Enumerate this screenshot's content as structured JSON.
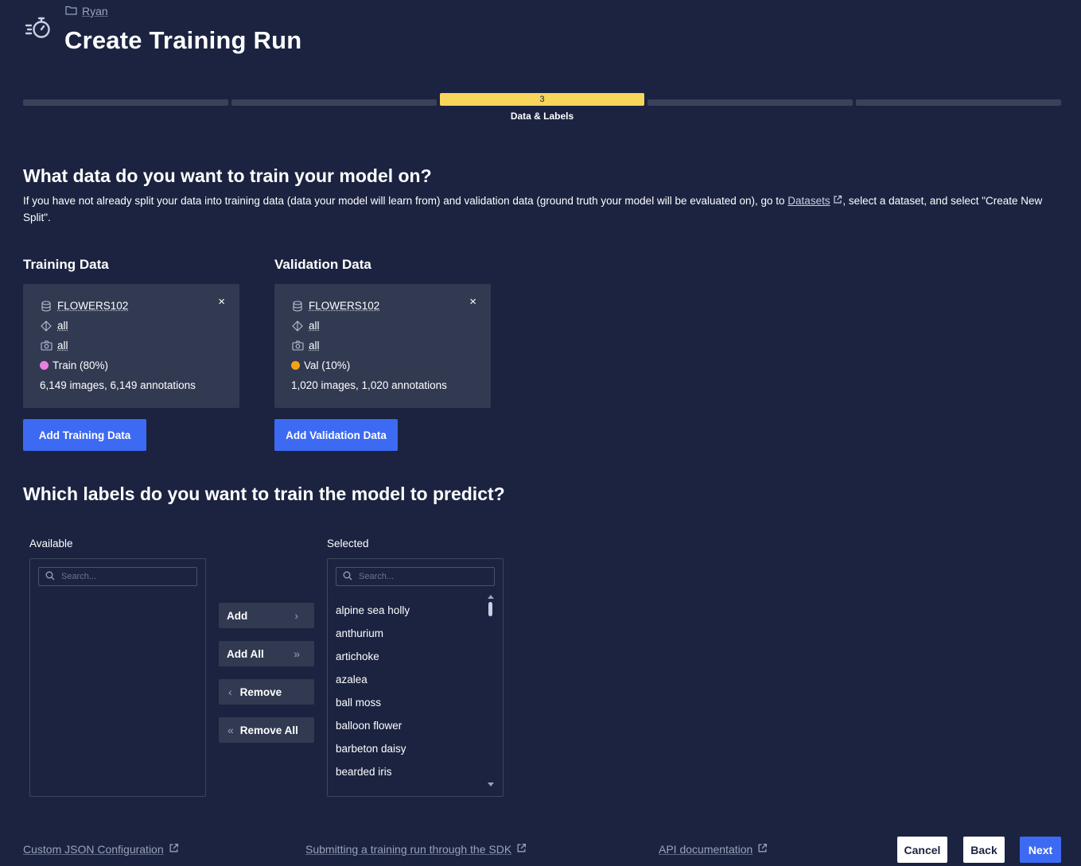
{
  "header": {
    "breadcrumb": "Ryan",
    "title": "Create Training Run"
  },
  "stepper": {
    "active_number": "3",
    "active_label": "Data & Labels",
    "accent_color": "#f7d65c"
  },
  "data_section": {
    "title": "What data do you want to train your model on?",
    "description_before": "If you have not already split your data into training data (data your model will learn from) and validation data (ground truth your model will be evaluated on), go to ",
    "description_link": "Datasets",
    "description_after": ", select a dataset, and select \"Create New Split\"."
  },
  "training": {
    "heading": "Training Data",
    "dataset": "FLOWERS102",
    "annotation_filter": "all",
    "image_filter": "all",
    "split": "Train (80%)",
    "split_color": "#e87fe0",
    "summary": "6,149 images, 6,149 annotations",
    "close": "×",
    "add_button": "Add Training Data"
  },
  "validation": {
    "heading": "Validation Data",
    "dataset": "FLOWERS102",
    "annotation_filter": "all",
    "image_filter": "all",
    "split": "Val (10%)",
    "split_color": "#f5a30f",
    "summary": "1,020 images, 1,020 annotations",
    "close": "×",
    "add_button": "Add Validation Data"
  },
  "labels_section": {
    "title": "Which labels do you want to train the model to predict?",
    "available": {
      "label": "Available",
      "search_placeholder": "Search..."
    },
    "selected": {
      "label": "Selected",
      "search_placeholder": "Search...",
      "items": [
        "alpine sea holly",
        "anthurium",
        "artichoke",
        "azalea",
        "ball moss",
        "balloon flower",
        "barbeton daisy",
        "bearded iris"
      ]
    },
    "buttons": {
      "add": "Add",
      "add_all": "Add All",
      "remove": "Remove",
      "remove_all": "Remove All"
    }
  },
  "footer": {
    "link_json": "Custom JSON Configuration",
    "link_sdk": "Submitting a training run through the SDK",
    "link_api": "API documentation",
    "cancel": "Cancel",
    "back": "Back",
    "next": "Next"
  },
  "colors": {
    "background": "#1b2340",
    "card": "#323a52",
    "primary": "#3d6af2"
  }
}
